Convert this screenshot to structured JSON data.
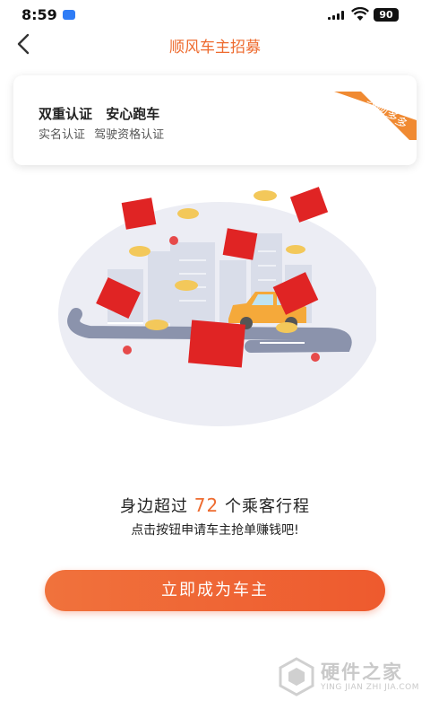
{
  "status_bar": {
    "time": "8:59",
    "battery": "90"
  },
  "nav": {
    "title": "顺风车主招募"
  },
  "card": {
    "headline": "双重认证 安心跑车",
    "subline": "实名认证 驾驶资格认证",
    "ribbon": "奖励多多"
  },
  "promo": {
    "prefix": "身边超过",
    "count": "72",
    "suffix": "个乘客行程",
    "sub": "点击按钮申请车主抢单赚钱吧!"
  },
  "cta": {
    "label": "立即成为车主"
  },
  "watermark": {
    "name": "硬件之家",
    "url": "YING JIAN ZHI JIA.COM"
  },
  "colors": {
    "accent": "#ee6b2f",
    "button": "#ee5a2e",
    "red_packet": "#e02424",
    "coin": "#f3c85a"
  }
}
